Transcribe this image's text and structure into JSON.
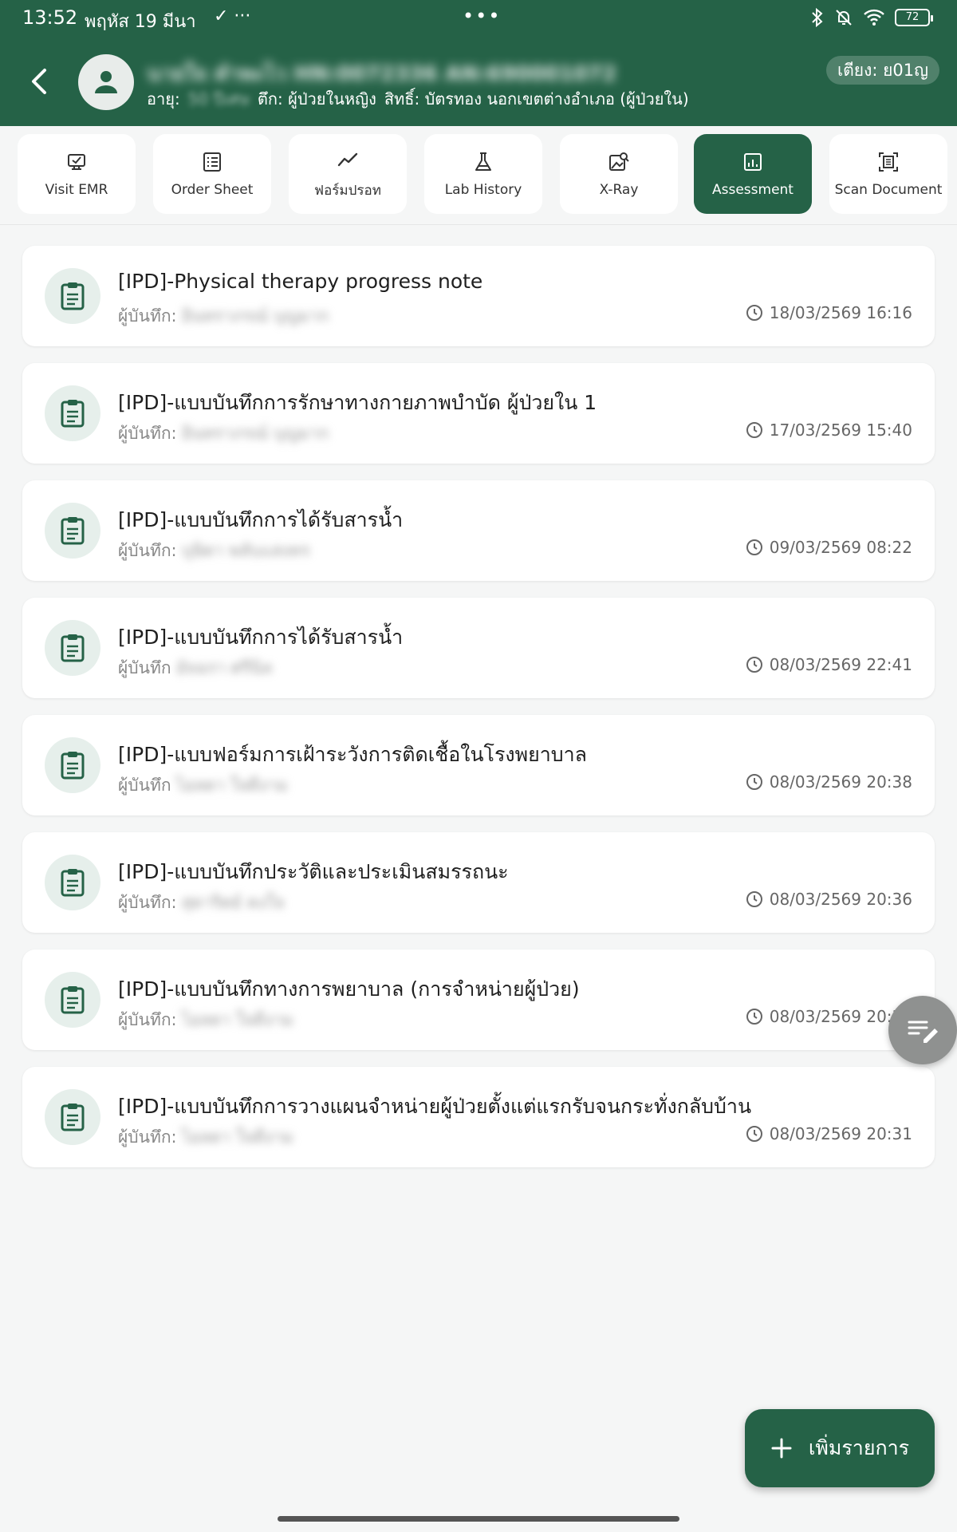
{
  "status_bar": {
    "time": "13:52",
    "date": "พฤหัส 19 มีนา",
    "left_icons": "✓ ···",
    "center_dots": "•••",
    "battery": "72"
  },
  "header": {
    "patient_name": "นายใจ คำพะไว HN:0072336 AN:690001072",
    "age_label": "อายุ:",
    "age_value": "50 ปีเศษ",
    "ward": "ตึก: ผู้ป่วยในหญิง",
    "rights": "สิทธิ์: บัตรทอง นอกเขตต่างอำเภอ (ผู้ป่วยใน)",
    "bed": "เตียง: ย01ญ"
  },
  "tabs": [
    {
      "label": "Visit EMR",
      "icon": "visit-emr-icon"
    },
    {
      "label": "Order Sheet",
      "icon": "order-sheet-icon"
    },
    {
      "label": "ฟอร์มปรอท",
      "icon": "trend-chart-icon"
    },
    {
      "label": "Lab History",
      "icon": "flask-icon"
    },
    {
      "label": "X-Ray",
      "icon": "xray-image-icon"
    },
    {
      "label": "Assessment",
      "icon": "assessment-chart-icon"
    },
    {
      "label": "Scan Document",
      "icon": "scan-document-icon"
    }
  ],
  "recorder_label": "ผู้บันทึก:",
  "recorder_label_short": "ผู้บันทึก",
  "records": [
    {
      "title": "[IPD]-Physical therapy progress note",
      "recorder": "อินทราภรณ์ บุญมาก",
      "datetime": "18/03/2569 16:16"
    },
    {
      "title": "[IPD]-แบบบันทึกการรักษาทางกายภาพบำบัด ผู้ป่วยใน 1",
      "recorder": "อินทราภรณ์ บุญมาก",
      "datetime": "17/03/2569 15:40"
    },
    {
      "title": "[IPD]-แบบบันทึกการได้รับสารน้ำ",
      "recorder": "บุษิตา พลับแสงทร",
      "datetime": "09/03/2569 08:22"
    },
    {
      "title": "[IPD]-แบบบันทึกการได้รับสารน้ำ",
      "recorder": "อัจฉรา ศรีนิล",
      "datetime": "08/03/2569 22:41"
    },
    {
      "title": "[IPD]-แบบฟอร์มการเฝ้าระวังการติดเชื้อในโรงพยาบาล",
      "recorder": "ไอลดา ใจดีงาม",
      "datetime": "08/03/2569 20:38"
    },
    {
      "title": "[IPD]-แบบบันทึกประวัติและประเมินสมรรถนะ",
      "recorder": "สุดาริตย์ คงใจ",
      "datetime": "08/03/2569 20:36"
    },
    {
      "title": "[IPD]-แบบบันทึกทางการพยาบาล (การจำหน่ายผู้ป่วย)",
      "recorder": "ไอลดา ใจดีงาม",
      "datetime": "08/03/2569 20:36"
    },
    {
      "title": "[IPD]-แบบบันทึกการวางแผนจำหน่ายผู้ป่วยตั้งแต่แรกรับจนกระทั่งกลับบ้าน",
      "recorder": "ไอลดา ใจดีงาม",
      "datetime": "08/03/2569 20:31"
    }
  ],
  "fab": {
    "add_label": "เพิ่มรายการ"
  },
  "colors": {
    "primary": "#256247",
    "card_icon_bg": "#e6efeb",
    "background": "#f5f6f6"
  }
}
